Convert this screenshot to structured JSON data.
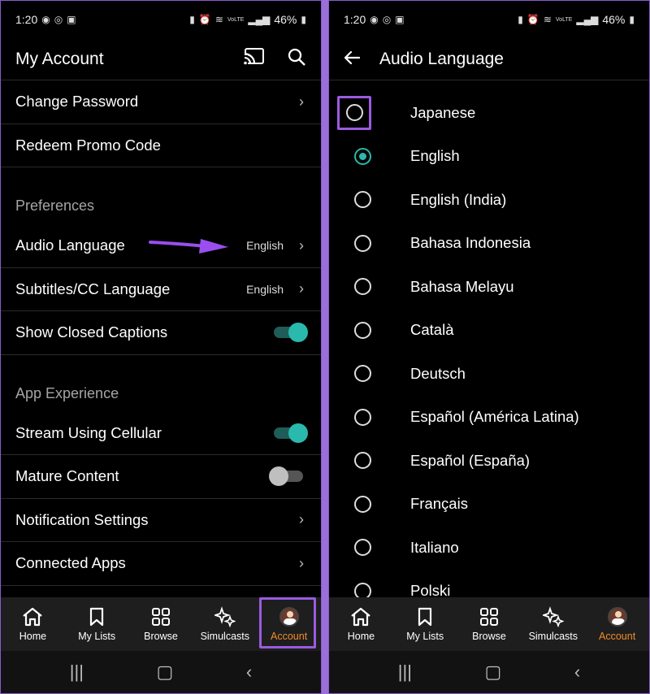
{
  "status": {
    "time": "1:20",
    "battery": "46%",
    "net": "VoLTE"
  },
  "left": {
    "title": "My Account",
    "account_rows": [
      {
        "label": "Change Password",
        "chevron": true
      },
      {
        "label": "Redeem Promo Code",
        "chevron": false
      }
    ],
    "preferences_header": "Preferences",
    "preference_rows": [
      {
        "label": "Audio Language",
        "value": "English"
      },
      {
        "label": "Subtitles/CC Language",
        "value": "English"
      },
      {
        "label": "Show Closed Captions",
        "toggle": "on"
      }
    ],
    "app_experience_header": "App Experience",
    "app_rows": [
      {
        "label": "Stream Using Cellular",
        "toggle": "on"
      },
      {
        "label": "Mature Content",
        "toggle": "off"
      },
      {
        "label": "Notification Settings",
        "chevron": true
      },
      {
        "label": "Connected Apps",
        "chevron": true
      }
    ]
  },
  "right": {
    "title": "Audio Language",
    "languages": [
      {
        "label": "Japanese",
        "selected": false
      },
      {
        "label": "English",
        "selected": true
      },
      {
        "label": "English (India)",
        "selected": false
      },
      {
        "label": "Bahasa Indonesia",
        "selected": false
      },
      {
        "label": "Bahasa Melayu",
        "selected": false
      },
      {
        "label": "Català",
        "selected": false
      },
      {
        "label": "Deutsch",
        "selected": false
      },
      {
        "label": "Español (América Latina)",
        "selected": false
      },
      {
        "label": "Español (España)",
        "selected": false
      },
      {
        "label": "Français",
        "selected": false
      },
      {
        "label": "Italiano",
        "selected": false
      },
      {
        "label": "Polski",
        "selected": false
      }
    ]
  },
  "nav": [
    {
      "label": "Home",
      "icon": "home-icon"
    },
    {
      "label": "My Lists",
      "icon": "bookmark-icon"
    },
    {
      "label": "Browse",
      "icon": "grid-icon"
    },
    {
      "label": "Simulcasts",
      "icon": "sparkle-icon"
    },
    {
      "label": "Account",
      "icon": "avatar"
    }
  ],
  "colors": {
    "accent_teal": "#2ab9ad",
    "accent_orange": "#f28c28",
    "highlight_purple": "#9a5be0"
  }
}
